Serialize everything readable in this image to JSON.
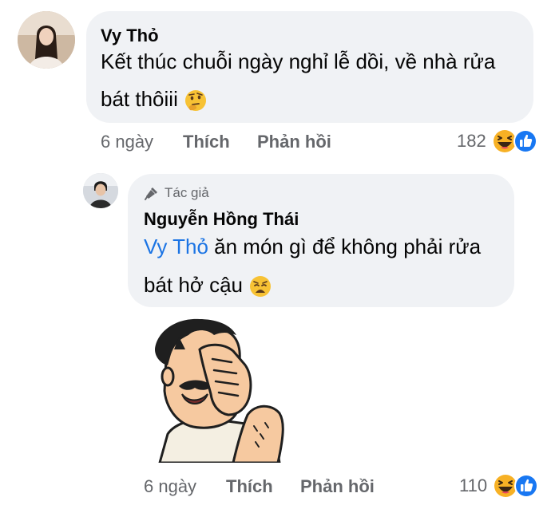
{
  "comment1": {
    "author": "Vy Thỏ",
    "text_line1": "Kết thúc chuỗi ngày nghỉ lễ dồi, về nhà rửa",
    "text_line2": "bát thôiii",
    "emoji": "thinking-face",
    "time": "6 ngày",
    "like_label": "Thích",
    "reply_label": "Phản hồi",
    "reaction_count": "182",
    "reactions": [
      "haha",
      "like"
    ]
  },
  "reply1": {
    "badge": "Tác giả",
    "author": "Nguyễn Hồng Thái",
    "mention": "Vy Thỏ",
    "text_line1_rest": " ăn món gì để không phải rửa",
    "text_line2": "bát hở cậu",
    "emoji": "weary-face",
    "sticker": "facepalm-sticker",
    "time": "6 ngày",
    "like_label": "Thích",
    "reply_label": "Phản hồi",
    "reaction_count": "110",
    "reactions": [
      "haha",
      "like"
    ]
  },
  "colors": {
    "bubble": "#f0f2f5",
    "mention": "#1b74e4",
    "meta": "#65676b",
    "like_blue": "#1877f2",
    "haha_yellow": "#f7b125"
  }
}
